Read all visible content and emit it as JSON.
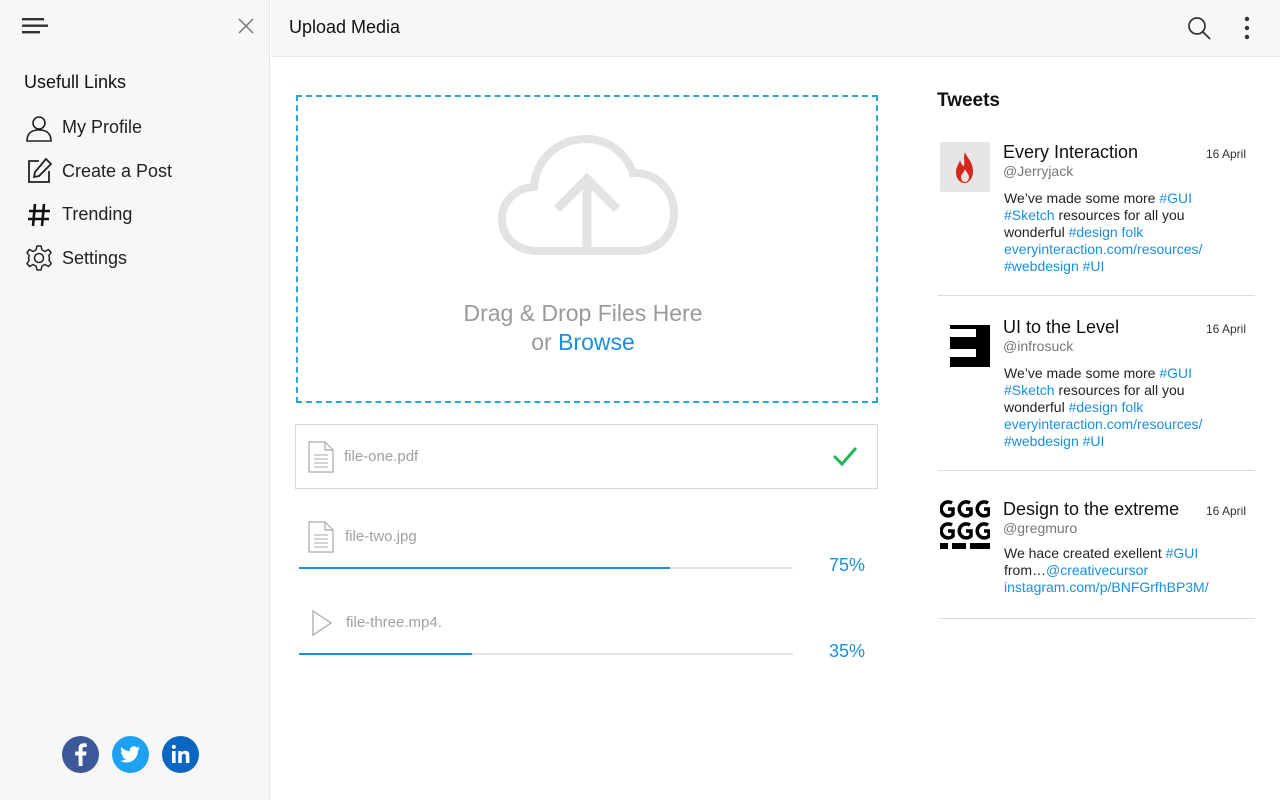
{
  "sidebar": {
    "heading": "Usefull Links",
    "items": [
      {
        "label": "My Profile",
        "icon": "user-icon"
      },
      {
        "label": "Create a Post",
        "icon": "edit-icon"
      },
      {
        "label": "Trending",
        "icon": "hashtag-icon"
      },
      {
        "label": "Settings",
        "icon": "gear-icon"
      }
    ],
    "social": [
      "facebook-icon",
      "twitter-icon",
      "linkedin-icon"
    ]
  },
  "header": {
    "title": "Upload Media"
  },
  "dropzone": {
    "line1": "Drag & Drop Files Here",
    "or": "or",
    "browse": "Browse"
  },
  "files": [
    {
      "name": "file-one.pdf",
      "status": "complete"
    },
    {
      "name": "file-two.jpg",
      "progress_label": "75%",
      "progress": 0.75
    },
    {
      "name": "file-three.mp4.",
      "progress_label": "35%",
      "progress": 0.35
    }
  ],
  "tweets": {
    "title": "Tweets",
    "items": [
      {
        "name": "Every Interaction",
        "handle": "@Jerryjack",
        "date": "16 April",
        "segments": [
          {
            "t": "We’ve made some more ",
            "link": false
          },
          {
            "t": "#GUI",
            "link": true
          },
          {
            "t": " ",
            "link": false
          },
          {
            "t": "#Sketch",
            "link": true
          },
          {
            "t": " resources for all you wonderful ",
            "link": false
          },
          {
            "t": "#design folk",
            "link": true
          },
          {
            "t": " ",
            "link": false
          },
          {
            "t": "everyinteraction.com/resources/",
            "link": true
          },
          {
            "t": " ",
            "link": false
          },
          {
            "t": "#webdesign",
            "link": true
          },
          {
            "t": " ",
            "link": false
          },
          {
            "t": "#UI",
            "link": true
          }
        ]
      },
      {
        "name": "UI to the Level",
        "handle": "@infrosuck",
        "date": "16 April",
        "segments": [
          {
            "t": "We’ve made some more ",
            "link": false
          },
          {
            "t": "#GUI",
            "link": true
          },
          {
            "t": " ",
            "link": false
          },
          {
            "t": "#Sketch",
            "link": true
          },
          {
            "t": " resources for all you wonderful ",
            "link": false
          },
          {
            "t": "#design folk",
            "link": true
          },
          {
            "t": " ",
            "link": false
          },
          {
            "t": "everyinteraction.com/resources/",
            "link": true
          },
          {
            "t": " ",
            "link": false
          },
          {
            "t": "#webdesign",
            "link": true
          },
          {
            "t": " ",
            "link": false
          },
          {
            "t": "#UI",
            "link": true
          }
        ]
      },
      {
        "name": "Design to the extreme",
        "handle": "@gregmuro",
        "date": "16 April",
        "segments": [
          {
            "t": "We hace created exellent ",
            "link": false
          },
          {
            "t": "#GUI",
            "link": true
          },
          {
            "t": " from…",
            "link": false
          },
          {
            "t": "@creativecursor",
            "link": true
          },
          {
            "t": " ",
            "link": false
          },
          {
            "t": "instagram.com/p/BNFGrfhBP3M/",
            "link": true
          }
        ]
      }
    ]
  },
  "colors": {
    "accent": "#1a8fe0",
    "dropzone_border": "#2aa6d8",
    "success": "#1db954",
    "facebook": "#3b5998",
    "twitter": "#1da1f2",
    "linkedin": "#0a66c2"
  }
}
